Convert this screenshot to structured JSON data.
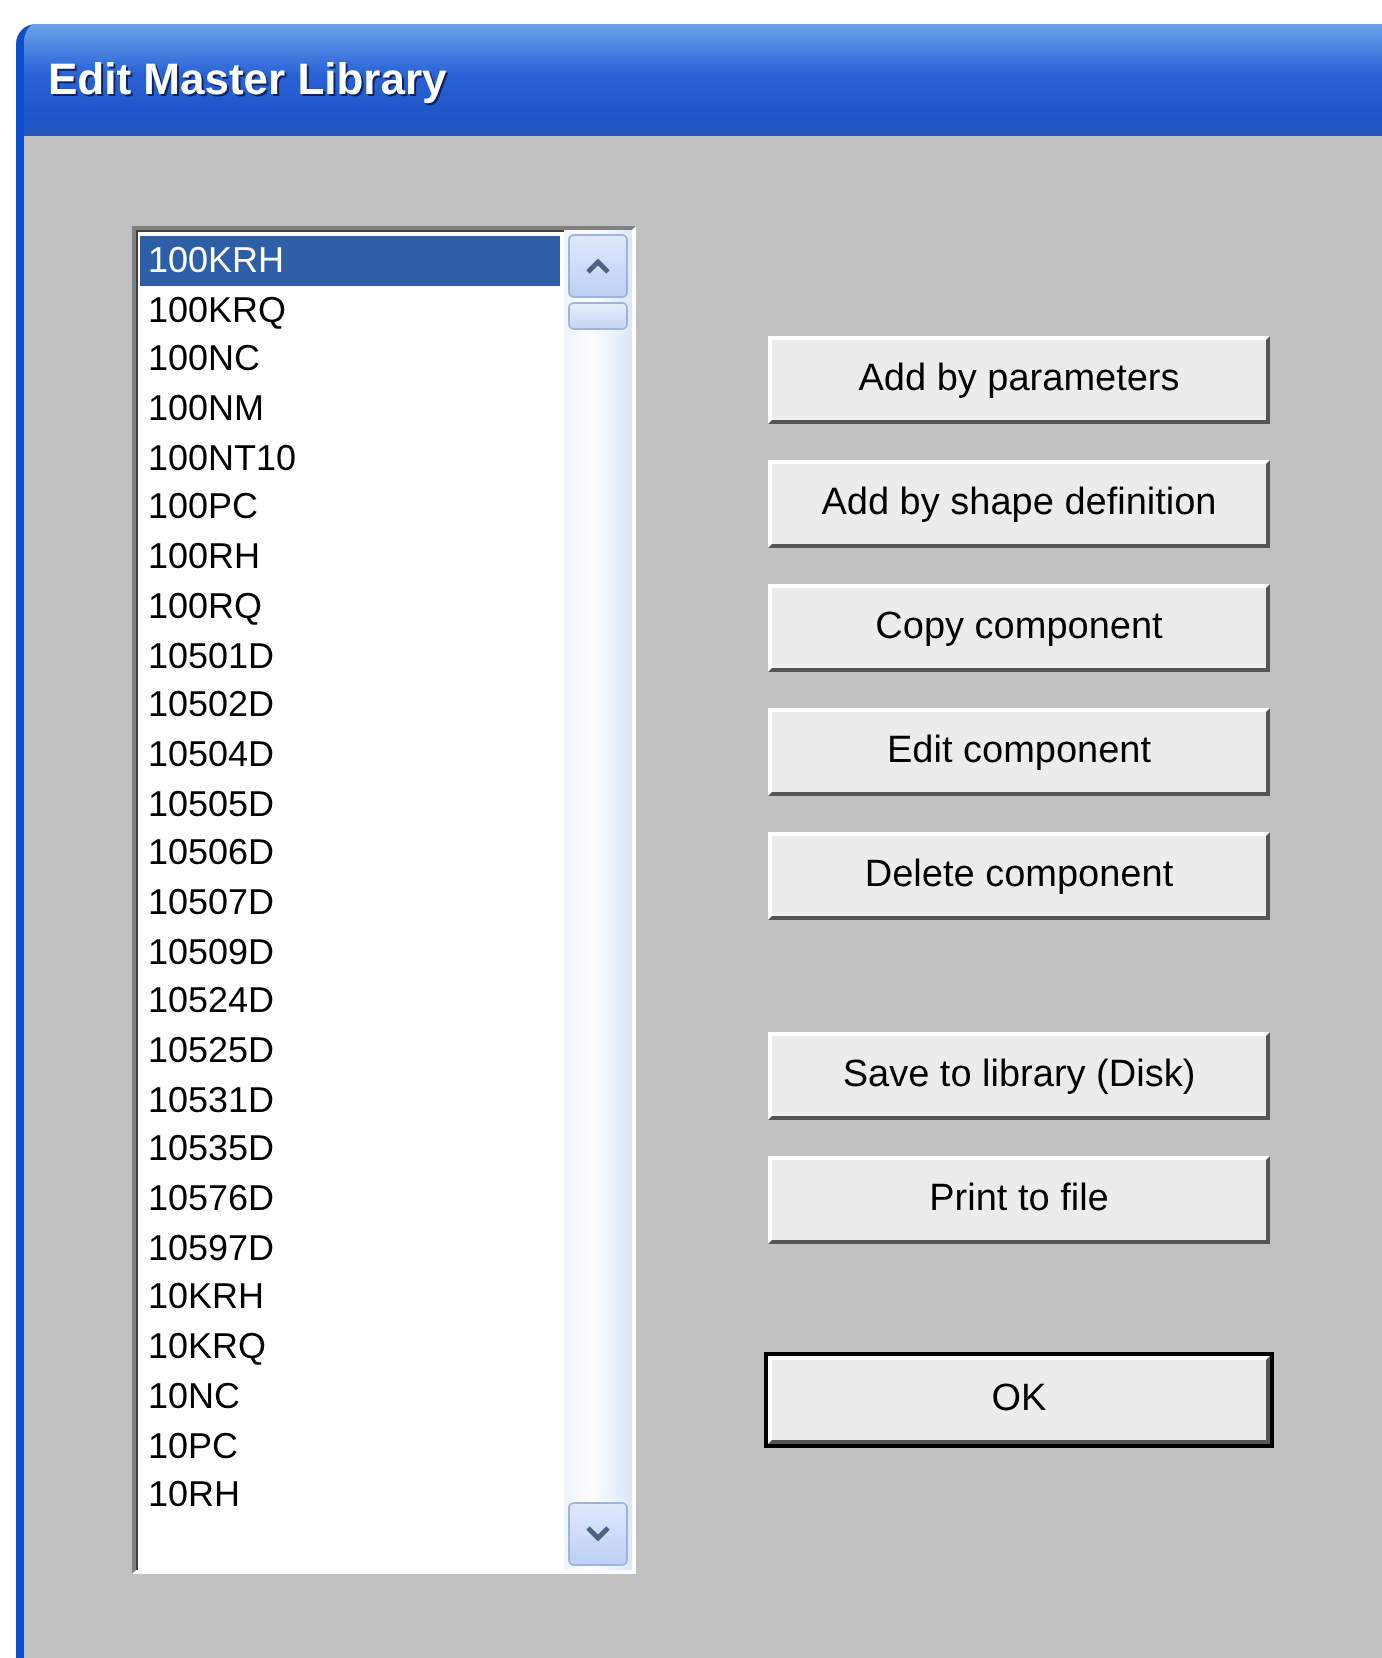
{
  "window": {
    "title": "Edit Master Library"
  },
  "list": {
    "items": [
      {
        "label": "100KRH",
        "selected": true
      },
      {
        "label": "100KRQ",
        "selected": false
      },
      {
        "label": "100NC",
        "selected": false
      },
      {
        "label": "100NM",
        "selected": false
      },
      {
        "label": "100NT10",
        "selected": false
      },
      {
        "label": "100PC",
        "selected": false
      },
      {
        "label": "100RH",
        "selected": false
      },
      {
        "label": "100RQ",
        "selected": false
      },
      {
        "label": "10501D",
        "selected": false
      },
      {
        "label": "10502D",
        "selected": false
      },
      {
        "label": "10504D",
        "selected": false
      },
      {
        "label": "10505D",
        "selected": false
      },
      {
        "label": "10506D",
        "selected": false
      },
      {
        "label": "10507D",
        "selected": false
      },
      {
        "label": "10509D",
        "selected": false
      },
      {
        "label": "10524D",
        "selected": false
      },
      {
        "label": "10525D",
        "selected": false
      },
      {
        "label": "10531D",
        "selected": false
      },
      {
        "label": "10535D",
        "selected": false
      },
      {
        "label": "10576D",
        "selected": false
      },
      {
        "label": "10597D",
        "selected": false
      },
      {
        "label": "10KRH",
        "selected": false
      },
      {
        "label": "10KRQ",
        "selected": false
      },
      {
        "label": "10NC",
        "selected": false
      },
      {
        "label": "10PC",
        "selected": false
      },
      {
        "label": "10RH",
        "selected": false
      }
    ]
  },
  "button_groups": [
    [
      {
        "label": "Add by parameters",
        "kind": "normal"
      },
      {
        "label": "Add by shape definition",
        "kind": "normal"
      },
      {
        "label": "Copy component",
        "kind": "normal"
      },
      {
        "label": "Edit component",
        "kind": "normal"
      },
      {
        "label": "Delete component",
        "kind": "normal"
      }
    ],
    [
      {
        "label": "Save to library (Disk)",
        "kind": "normal"
      },
      {
        "label": "Print to file",
        "kind": "normal"
      }
    ],
    [
      {
        "label": "OK",
        "kind": "default"
      }
    ]
  ]
}
